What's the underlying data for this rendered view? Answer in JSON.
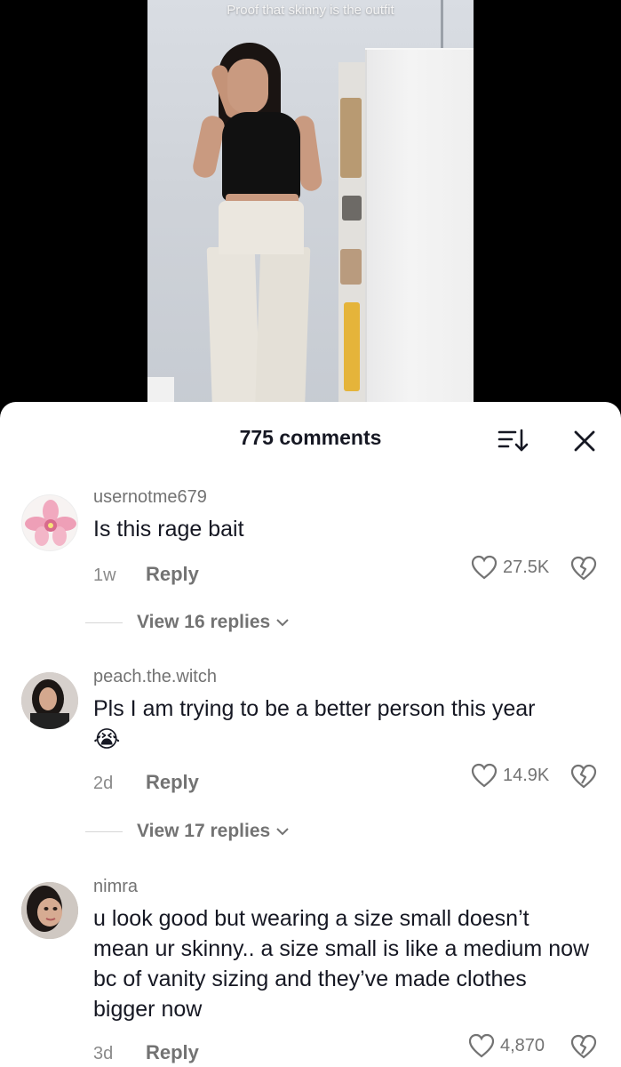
{
  "video": {
    "caption": "Proof that skinny is the outfit"
  },
  "comments_panel": {
    "title": "775 comments",
    "sort_icon": "sort-icon",
    "close_icon": "close-icon"
  },
  "comments": [
    {
      "username": "usernotme679",
      "text": "Is this rage bait",
      "time": "1w",
      "reply_label": "Reply",
      "likes": "27.5K",
      "view_replies": "View 16 replies",
      "avatar": "orchid-flower-avatar"
    },
    {
      "username": "peach.the.witch",
      "text": "Pls I am trying to be a better person this year",
      "emoji": "😭",
      "time": "2d",
      "reply_label": "Reply",
      "likes": "14.9K",
      "view_replies": "View 17 replies",
      "avatar": "woman-dark-hair-avatar"
    },
    {
      "username": "nimra",
      "text": "u look good but wearing a size small doesn’t mean ur skinny.. a size small is like a medium now bc of vanity sizing and they’ve made clothes bigger now",
      "time": "3d",
      "reply_label": "Reply",
      "likes": "4,870",
      "avatar": "woman-selfie-avatar"
    }
  ],
  "colors": {
    "sheet_bg": "#ffffff",
    "text_primary": "#161823",
    "text_secondary": "#737373"
  }
}
